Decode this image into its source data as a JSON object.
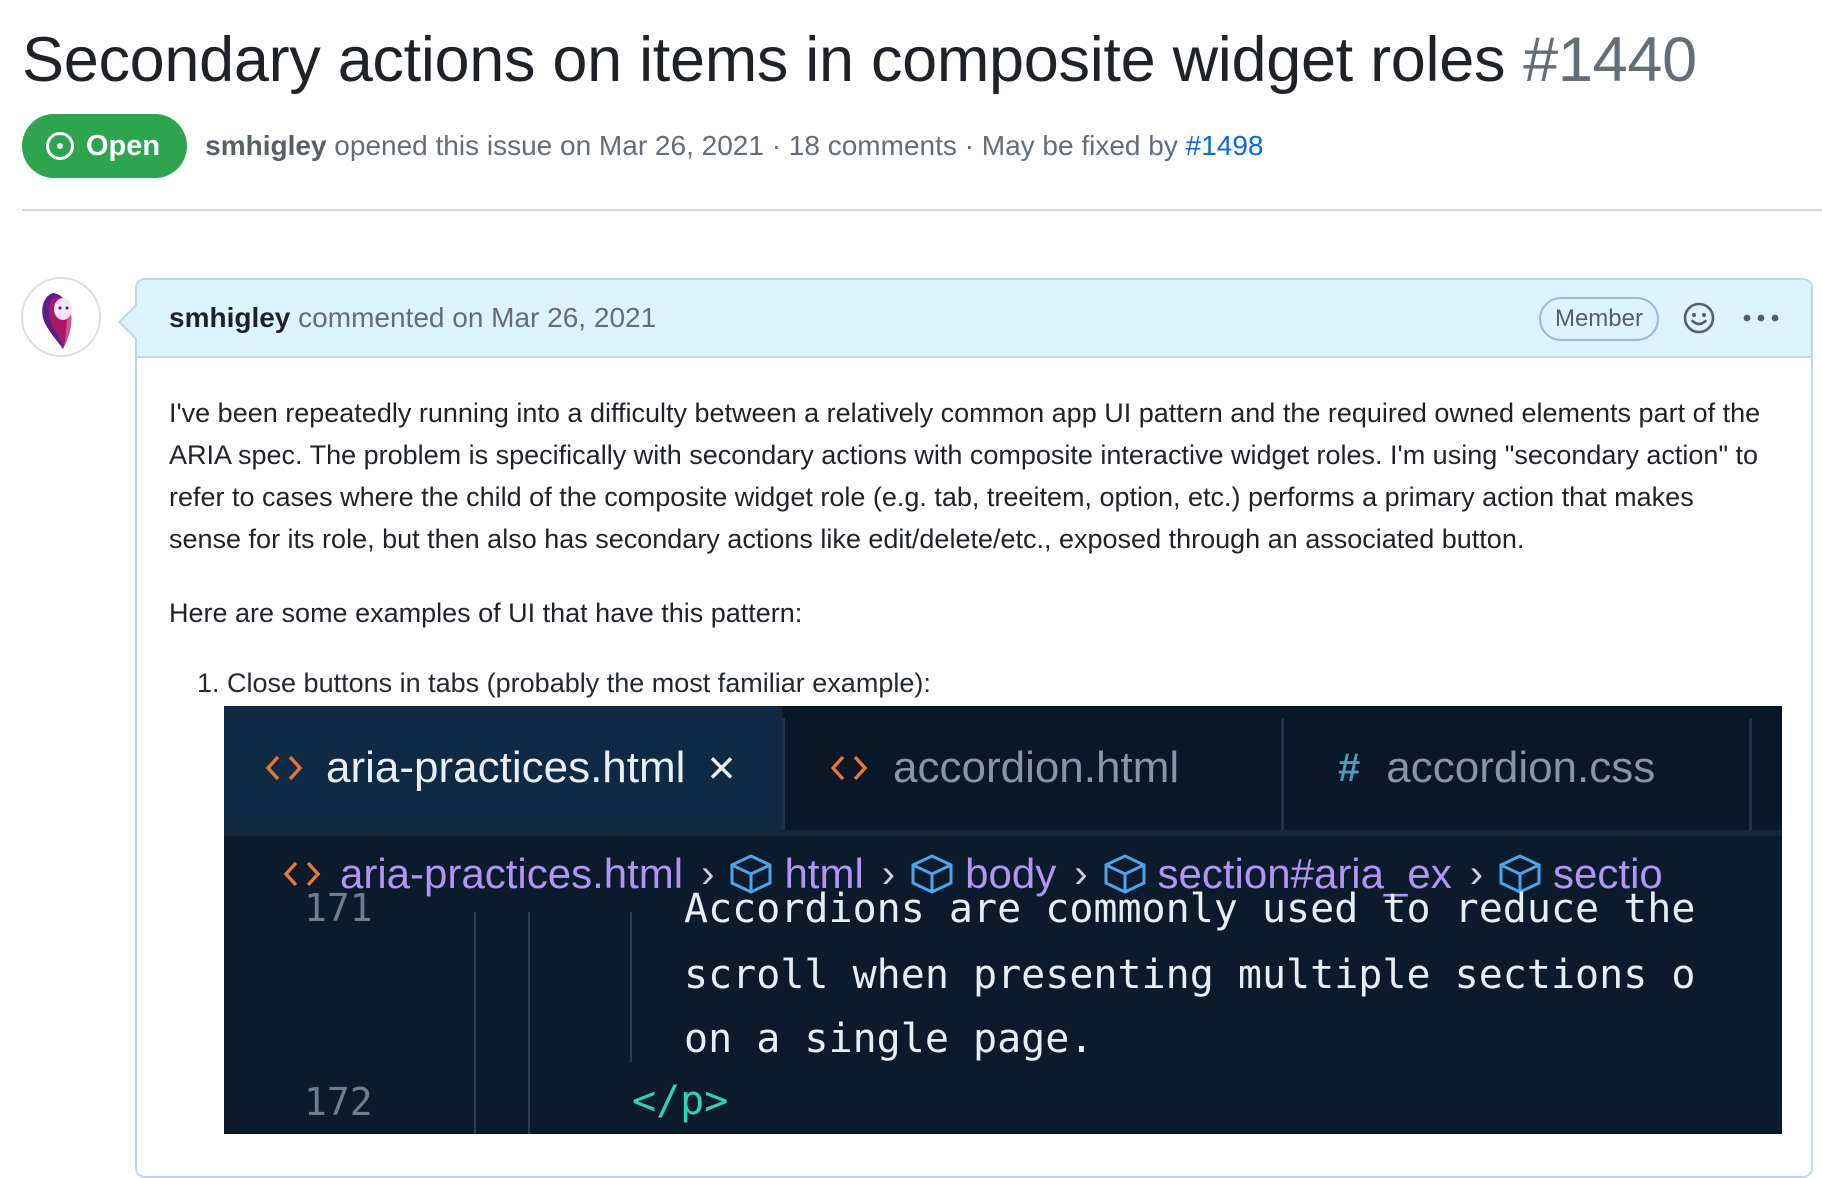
{
  "issue": {
    "title": "Secondary actions on items in composite widget roles",
    "number": "#1440",
    "state": "Open",
    "author": "smhigley",
    "opened_text": "opened this issue on Mar 26, 2021 · 18 comments · May be fixed by",
    "fix_link": "#1498"
  },
  "comment": {
    "author": "smhigley",
    "action_text": "commented on Mar 26, 2021",
    "role_badge": "Member",
    "paragraphs": [
      "I've been repeatedly running into a difficulty between a relatively common app UI pattern and the required owned elements part of the ARIA spec. The problem is specifically with secondary actions with composite interactive widget roles. I'm using \"secondary action\" to refer to cases where the child of the composite widget role (e.g. tab, treeitem, option, etc.) performs a primary action that makes sense for its role, but then also has secondary actions like edit/delete/etc., exposed through an associated button.",
      "Here are some examples of UI that have this pattern:"
    ],
    "list_item": "1. Close buttons in tabs (probably the most familiar example):"
  },
  "screenshot": {
    "tabs": [
      {
        "icon": "<>",
        "label": "aria-practices.html",
        "close": "×"
      },
      {
        "icon": "<>",
        "label": "accordion.html"
      },
      {
        "icon": "#",
        "label": "accordion.css"
      }
    ],
    "breadcrumbs": [
      "aria-practices.html",
      "html",
      "body",
      "section#aria_ex",
      "sectio"
    ],
    "code_lines": [
      "Accordions are commonly used to reduce the",
      "scroll when presenting multiple sections o",
      "on a single page."
    ],
    "line_partial": "171",
    "line_number": "172",
    "closing_tag": "</p>"
  },
  "colors": {
    "open_green": "#2da44e",
    "link_blue": "#0969da",
    "comment_header_bg": "#ddf4ff",
    "editor_bg": "#0b1b2c",
    "html_icon_orange": "#e37933",
    "css_icon_blue": "#519aba",
    "breadcrumb_purple": "#b294f5",
    "tag_teal": "#34d0b4"
  }
}
